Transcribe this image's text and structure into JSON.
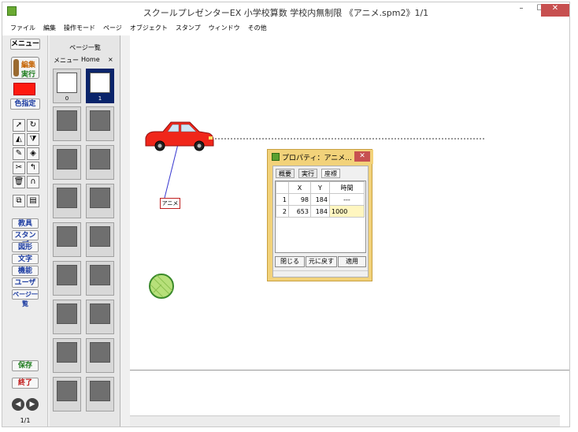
{
  "window": {
    "title": "スクールプレゼンターEX 小学校算数 学校内無制限 《アニメ.spm2》1/1",
    "minimize": "–",
    "maximize": "☐",
    "close": "✕"
  },
  "menu": [
    "ファイル",
    "編集",
    "操作モード",
    "ページ",
    "オブジェクト",
    "スタンプ",
    "ウィンドウ",
    "その他"
  ],
  "toolbar": {
    "menu_label": "メニュー",
    "mode_edit": "編集",
    "mode_run": "実行",
    "color_label": "色指定",
    "current_color": "#ff1a0f",
    "categories": [
      "教具",
      "スタンプ",
      "図形",
      "文字",
      "機能",
      "ユーザー",
      "ページ一覧"
    ],
    "save_label": "保存",
    "exit_label": "終了",
    "page_counter": "1/1"
  },
  "page_panel": {
    "title": "ページ一覧",
    "tab_menu": "メニュー",
    "tab_home": "Home",
    "tab_close": "×",
    "page_numbers": [
      "0",
      "1"
    ]
  },
  "canvas": {
    "anime_tag": "アニメ"
  },
  "dialog": {
    "title": "プロパティ：アニメ...",
    "close": "✕",
    "tabs": [
      "概要",
      "実行",
      "座標"
    ],
    "columns": [
      "",
      "X",
      "Y",
      "時間"
    ],
    "rows": [
      {
        "n": "1",
        "x": "98",
        "y": "184",
        "t": "---"
      },
      {
        "n": "2",
        "x": "653",
        "y": "184",
        "t": "1000"
      }
    ],
    "btn_close": "閉じる",
    "btn_reset": "元に戻す",
    "btn_apply": "適用"
  }
}
